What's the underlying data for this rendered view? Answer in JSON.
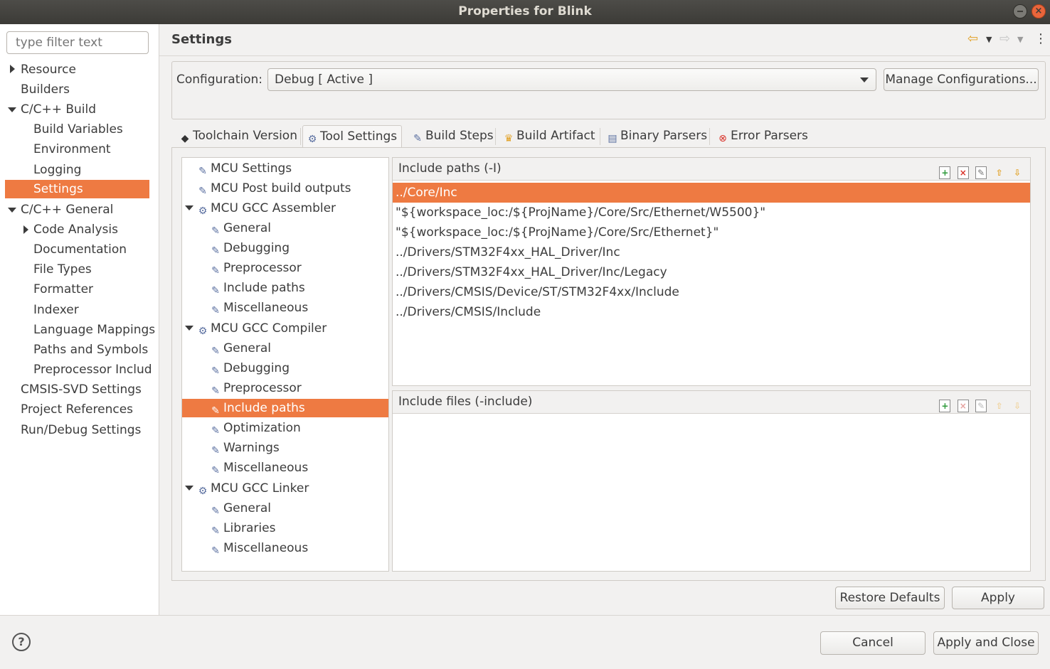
{
  "window": {
    "title": "Properties for Blink"
  },
  "filter": {
    "placeholder": "type filter text"
  },
  "left_tree": [
    {
      "label": "Resource"
    },
    {
      "label": "Builders"
    },
    {
      "label": "C/C++ Build"
    },
    {
      "label": "Build Variables"
    },
    {
      "label": "Environment"
    },
    {
      "label": "Logging"
    },
    {
      "label": "Settings"
    },
    {
      "label": "C/C++ General"
    },
    {
      "label": "Code Analysis"
    },
    {
      "label": "Documentation"
    },
    {
      "label": "File Types"
    },
    {
      "label": "Formatter"
    },
    {
      "label": "Indexer"
    },
    {
      "label": "Language Mappings"
    },
    {
      "label": "Paths and Symbols"
    },
    {
      "label": "Preprocessor Includ"
    },
    {
      "label": "CMSIS-SVD Settings"
    },
    {
      "label": "Project References"
    },
    {
      "label": "Run/Debug Settings"
    }
  ],
  "page": {
    "title": "Settings"
  },
  "config": {
    "label": "Configuration:",
    "value": "Debug  [ Active ]",
    "manage_label": "Manage Configurations..."
  },
  "tabs": [
    {
      "label": "Toolchain Version",
      "icon": "toolchain-icon"
    },
    {
      "label": "Tool Settings",
      "icon": "tool-settings-icon"
    },
    {
      "label": "Build Steps",
      "icon": "build-steps-icon"
    },
    {
      "label": "Build Artifact",
      "icon": "trophy-icon"
    },
    {
      "label": "Binary Parsers",
      "icon": "binary-parsers-icon"
    },
    {
      "label": "Error Parsers",
      "icon": "error-icon"
    }
  ],
  "tool_tree": [
    {
      "label": "MCU Settings"
    },
    {
      "label": "MCU Post build outputs"
    },
    {
      "label": "MCU GCC Assembler"
    },
    {
      "label": "General"
    },
    {
      "label": "Debugging"
    },
    {
      "label": "Preprocessor"
    },
    {
      "label": "Include paths"
    },
    {
      "label": "Miscellaneous"
    },
    {
      "label": "MCU GCC Compiler"
    },
    {
      "label": "General"
    },
    {
      "label": "Debugging"
    },
    {
      "label": "Preprocessor"
    },
    {
      "label": "Include paths"
    },
    {
      "label": "Optimization"
    },
    {
      "label": "Warnings"
    },
    {
      "label": "Miscellaneous"
    },
    {
      "label": "MCU GCC Linker"
    },
    {
      "label": "General"
    },
    {
      "label": "Libraries"
    },
    {
      "label": "Miscellaneous"
    }
  ],
  "include_paths": {
    "title": "Include paths (-I)",
    "items": [
      "../Core/Inc",
      "\"${workspace_loc:/${ProjName}/Core/Src/Ethernet/W5500}\"",
      "\"${workspace_loc:/${ProjName}/Core/Src/Ethernet}\"",
      "../Drivers/STM32F4xx_HAL_Driver/Inc",
      "../Drivers/STM32F4xx_HAL_Driver/Inc/Legacy",
      "../Drivers/CMSIS/Device/ST/STM32F4xx/Include",
      "../Drivers/CMSIS/Include"
    ]
  },
  "include_files": {
    "title": "Include files (-include)"
  },
  "buttons": {
    "restore": "Restore Defaults",
    "apply": "Apply",
    "cancel": "Cancel",
    "apply_close": "Apply and Close"
  },
  "colors": {
    "selection": "#ee7a42",
    "titlebar": "#3c3b37"
  }
}
